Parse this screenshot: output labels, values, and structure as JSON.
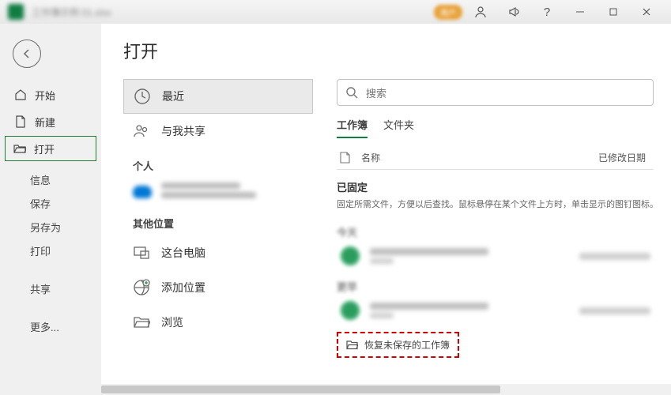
{
  "titlebar": {
    "doc_title": "工作簿示例 01.xlsx",
    "user_name": "用户"
  },
  "sidebar": {
    "home": "开始",
    "new": "新建",
    "open": "打开",
    "info": "信息",
    "save": "保存",
    "save_as": "另存为",
    "print": "打印",
    "share": "共享",
    "more": "更多..."
  },
  "page": {
    "title": "打开"
  },
  "sources": {
    "recent": "最近",
    "shared": "与我共享",
    "personal_heading": "个人",
    "onedrive_name": "OneDrive - 个人",
    "onedrive_email": "example@qq.com",
    "other_heading": "其他位置",
    "this_pc": "这台电脑",
    "add_place": "添加位置",
    "browse": "浏览"
  },
  "search": {
    "placeholder": "搜索"
  },
  "tabs": {
    "workbooks": "工作簿",
    "folders": "文件夹"
  },
  "columns": {
    "name": "名称",
    "modified": "已修改日期"
  },
  "pinned": {
    "title": "已固定",
    "desc": "固定所需文件，方便以后查找。鼠标悬停在某个文件上方时，单击显示的图钉图标。"
  },
  "groups": {
    "today": "今天",
    "earlier": "更早"
  },
  "recover": {
    "label": "恢复未保存的工作簿"
  }
}
